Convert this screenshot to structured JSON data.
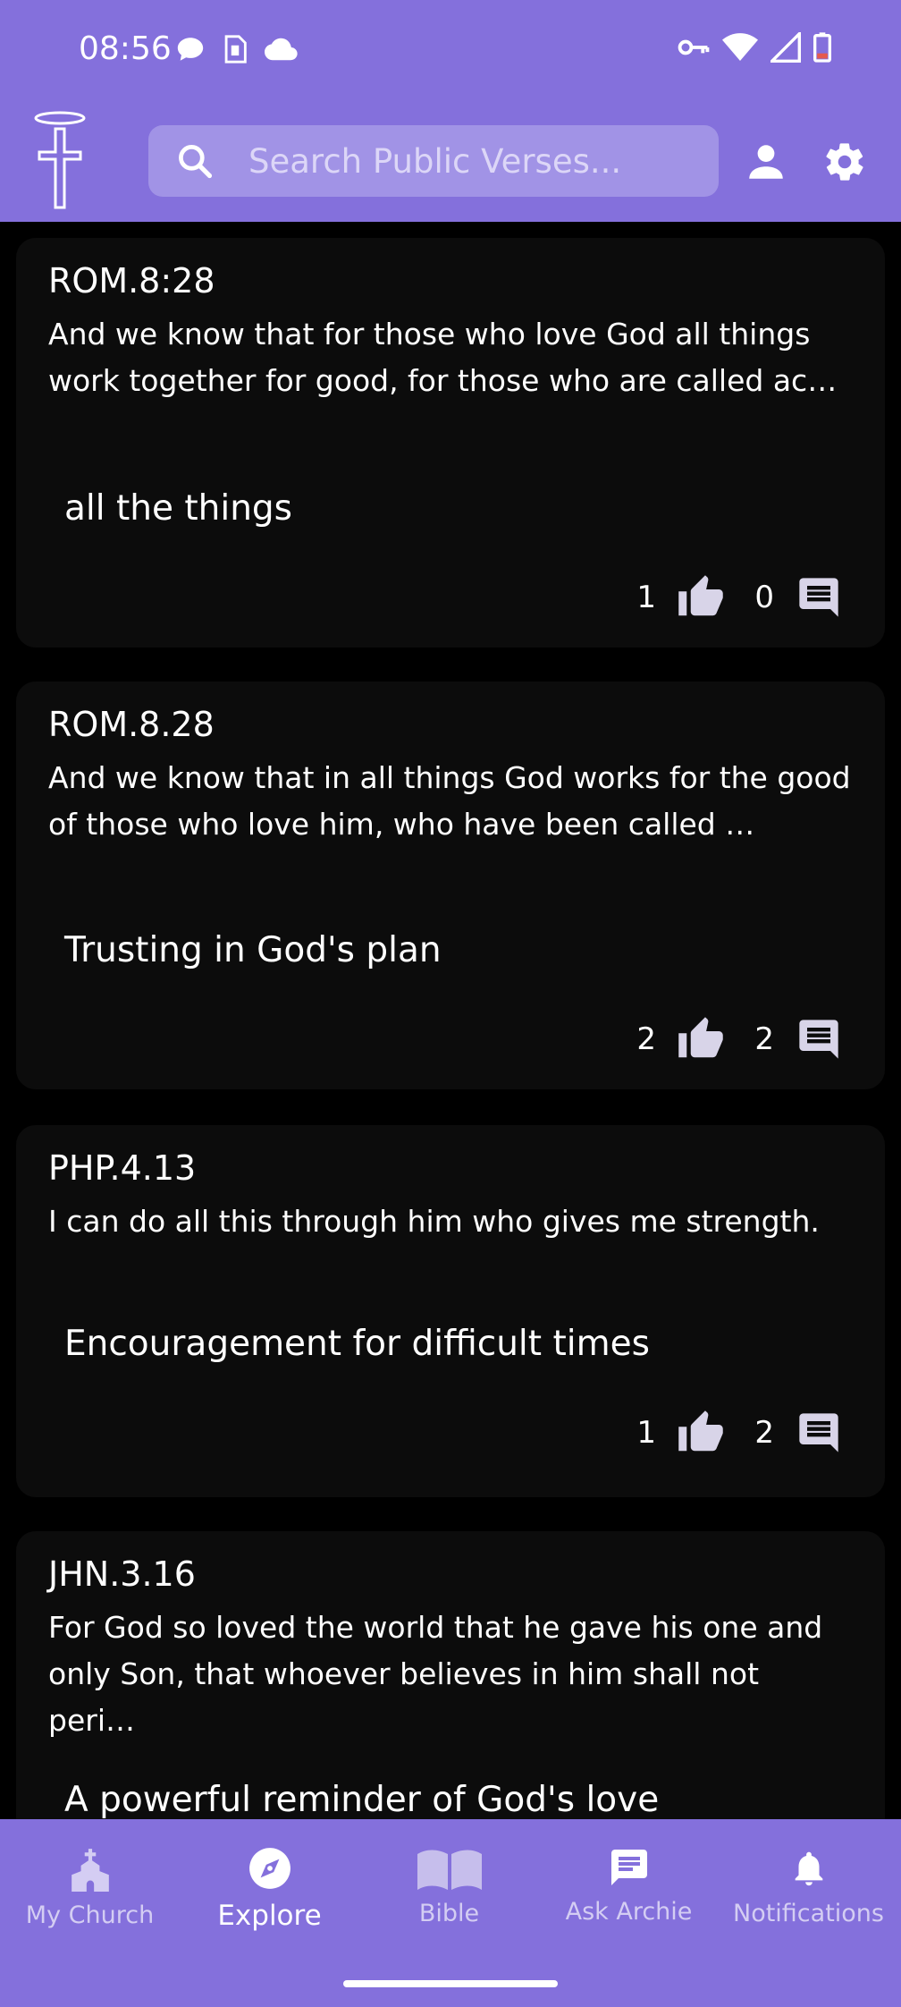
{
  "status_bar": {
    "time": "08:56",
    "icons_left": [
      "chat-bubble-icon",
      "sim-card-icon",
      "cloud-icon"
    ],
    "icons_right": [
      "vpn-key-icon",
      "wifi-icon",
      "cell-signal-icon",
      "battery-low-icon"
    ]
  },
  "app_bar": {
    "logo": "cross-halo-logo",
    "search_placeholder": "Search Public Verses...",
    "profile_icon": "person-icon",
    "settings_icon": "gear-icon"
  },
  "posts": [
    {
      "ref": "ROM.8:28",
      "verse": "And we know that for those who love God all things work together for good, for those who are called ac…",
      "note": "all the things",
      "likes": "1",
      "comments": "0"
    },
    {
      "ref": "ROM.8.28",
      "verse": "And we know that in all things God works for the good of those who love him, who have been called …",
      "note": "Trusting in God's plan",
      "likes": "2",
      "comments": "2"
    },
    {
      "ref": "PHP.4.13",
      "verse": "I can do all this through him who gives me strength.",
      "note": "Encouragement for difficult times",
      "likes": "1",
      "comments": "2"
    },
    {
      "ref": "JHN.3.16",
      "verse": "For God so loved the world that he gave his one and only Son, that whoever believes in him shall not peri…",
      "note": "A powerful reminder of God's love",
      "likes": "",
      "comments": ""
    }
  ],
  "nav": {
    "items": [
      {
        "label": "My Church",
        "icon": "church-icon"
      },
      {
        "label": "Explore",
        "icon": "compass-icon",
        "active": true
      },
      {
        "label": "Bible",
        "icon": "open-book-icon"
      },
      {
        "label": "Ask Archie",
        "icon": "chat-icon"
      },
      {
        "label": "Notifications",
        "icon": "bell-icon"
      }
    ]
  },
  "colors": {
    "brand": "#8470DC",
    "card_bg": "#0C0C0C",
    "page_bg": "#000000",
    "search_bg": "#A193E6"
  }
}
